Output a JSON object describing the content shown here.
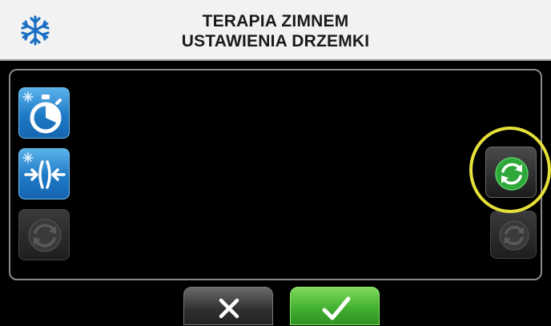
{
  "header": {
    "icon": "snowflake-icon",
    "title_line1": "TERAPIA ZIMNEM",
    "title_line2": "USTAWIENIA DRZEMKI"
  },
  "left_buttons": [
    {
      "icon": "cold-timer-icon",
      "state": "active"
    },
    {
      "icon": "cold-compression-icon",
      "state": "active"
    },
    {
      "icon": "cycle-icon",
      "state": "disabled"
    }
  ],
  "right_buttons": [
    {
      "icon": "cycle-icon",
      "state": "selected",
      "accent": "#2fa83a"
    },
    {
      "icon": "cycle-icon",
      "state": "disabled"
    }
  ],
  "highlight_color": "#e6e03a",
  "footer": {
    "cancel_icon": "close-icon",
    "confirm_icon": "check-icon"
  },
  "colors": {
    "header_bg": "#f2f2f2",
    "blue_tile": "#1f7ac6",
    "confirm_green": "#3fae2f"
  }
}
